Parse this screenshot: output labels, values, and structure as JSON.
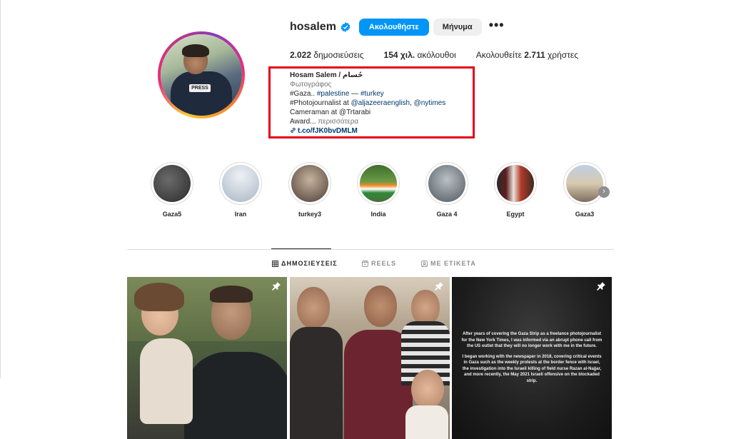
{
  "profile": {
    "username": "hosalem",
    "follow_label": "Ακολουθήστε",
    "message_label": "Μήνυμα",
    "more_label": "•••",
    "stats": {
      "posts_count": "2.022",
      "posts_label": "δημοσιεύσεις",
      "followers_count": "154 χιλ.",
      "followers_label": "ακόλουθοι",
      "following_prefix": "Ακολουθείτε",
      "following_count": "2.711",
      "following_suffix": "χρήστες"
    },
    "bio": {
      "name": "Hosam Salem / حُسام",
      "category": "Φωτογράφος",
      "line1_prefix": "#Gaza.. ",
      "line1_tag1": "#palestine",
      "line1_sep": " — ",
      "line1_tag2": "#turkey",
      "line2_prefix": "#Photojournalist at ",
      "line2_mention1": "@aljazeeraenglish",
      "line2_sep": ", ",
      "line2_mention2": "@nytimes",
      "line3": "Cameraman at @Trtarabi",
      "line4_text": "Award... ",
      "line4_more": "περισσότερα",
      "link": "t.co/fJK0bvDMLM"
    }
  },
  "highlights": [
    {
      "label": "Gaza5",
      "color": "#3b3b3b"
    },
    {
      "label": "Iran",
      "color": "#c9d3de"
    },
    {
      "label": "turkey3",
      "color": "#7d6b5a"
    },
    {
      "label": "India",
      "color": "#4d7a3a"
    },
    {
      "label": "Gaza 4",
      "color": "#8a9299"
    },
    {
      "label": "Egypt",
      "color": "#a34a3a"
    },
    {
      "label": "Gaza3",
      "color": "#9aa9b8"
    }
  ],
  "tabs": {
    "posts": "ΔΗΜΟΣΙΕΥΣΕΙΣ",
    "reels": "REELS",
    "tagged": "ΜΕ ΕΤΙΚΕΤΑ"
  },
  "posts": {
    "third_post_para1": "After years of covering the Gaza Strip as a freelance photojournalist for the New York Times, I was informed via an abrupt phone call from the US outlet that they will no longer work with me in the future.",
    "third_post_para2": "I began working with the newspaper in 2018, covering critical events in Gaza such as the weekly protests at the border fence with Israel, the investigation into the Israeli killing of field nurse Razan al-Najjar, and more recently, the May 2021 Israeli offensive on the blockaded strip."
  },
  "avatar_badge": "PRESS",
  "colors": {
    "follow_button": "#0095f6",
    "highlight_box": "#e4001b",
    "link": "#00376b"
  }
}
